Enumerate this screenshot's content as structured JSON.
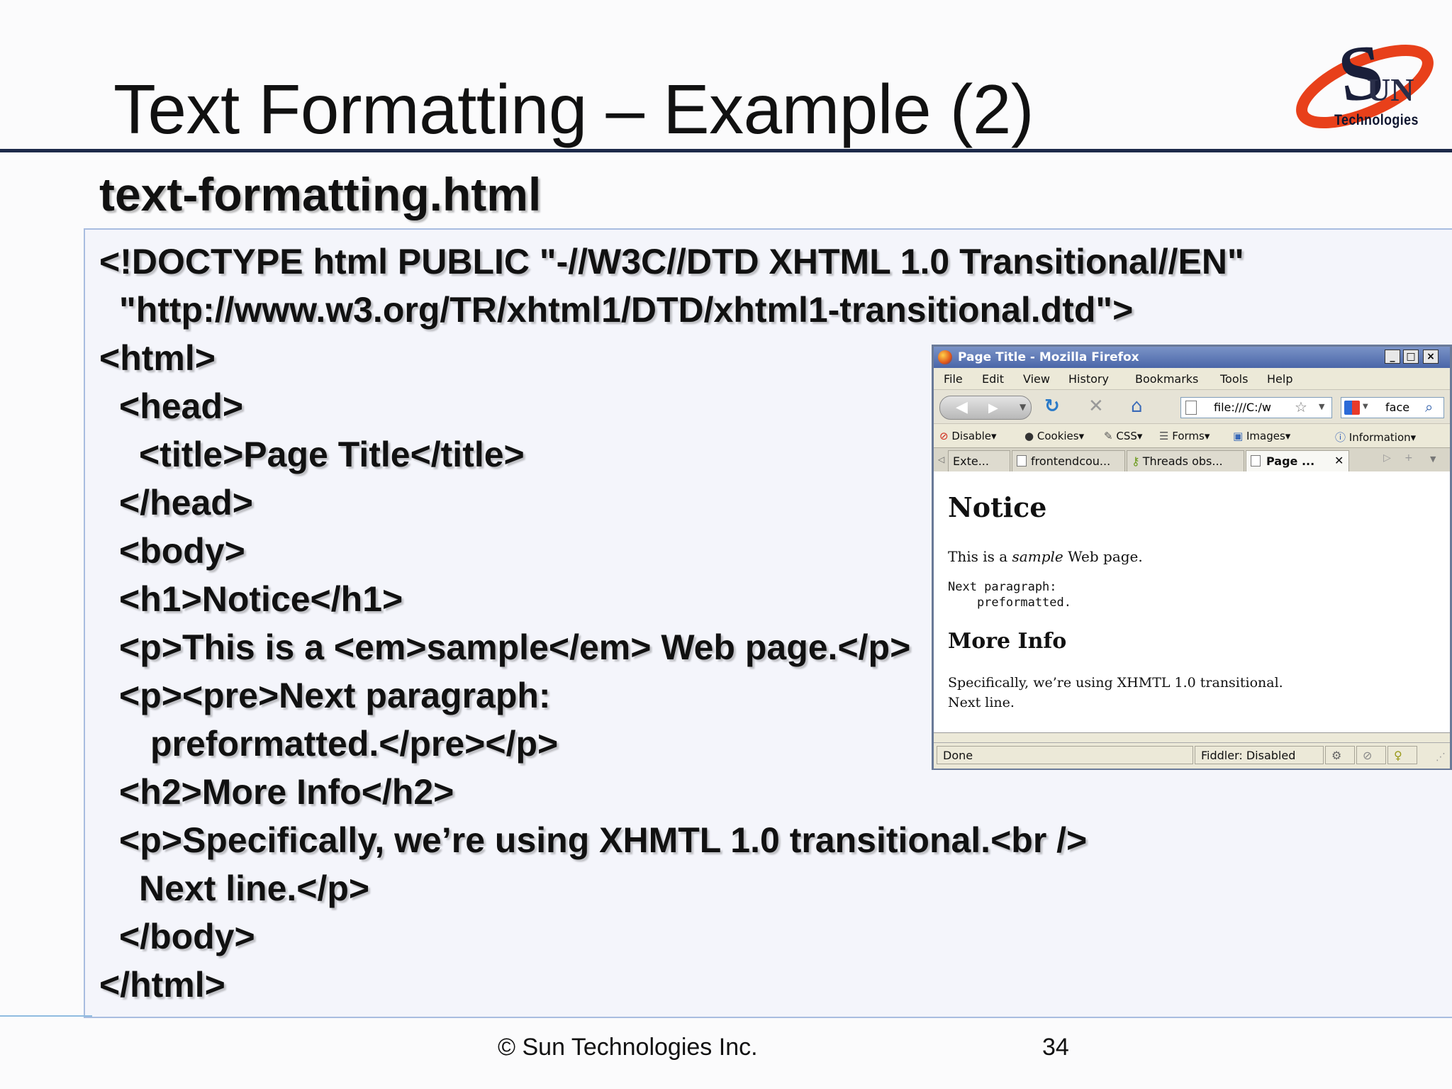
{
  "slide": {
    "title": "Text Formatting – Example (2)",
    "logo_text": "Technologies",
    "filename": "text-formatting.html"
  },
  "code_lines": [
    "<!DOCTYPE html PUBLIC \"-//W3C//DTD XHTML 1.0 Transitional//EN\"",
    "\"http://www.w3.org/TR/xhtml1/DTD/xhtml1-transitional.dtd\">",
    "<html>",
    "<head>",
    "<title>Page Title</title>",
    "</head>",
    "<body>",
    "<h1>Notice</h1>",
    "<p>This is a <em>sample</em> Web page.</p>",
    "<p><pre>Next paragraph:",
    "preformatted.</pre></p>",
    "<h2>More Info</h2>",
    "<p>Specifically, we’re using XHMTL 1.0 transitional.<br />",
    "Next line.</p>",
    "</body>",
    "</html>"
  ],
  "browser": {
    "window_title": "Page Title - Mozilla Firefox",
    "menu": [
      "File",
      "Edit",
      "View",
      "History",
      "Bookmarks",
      "Tools",
      "Help"
    ],
    "url": "file:///C:/w",
    "search": "face",
    "webdev_toolbar": [
      "Disable",
      "Cookies",
      "CSS",
      "Forms",
      "Images",
      "Information"
    ],
    "tabs": [
      "Exte...",
      "frontendcou...",
      "Threads obs...",
      "Page ..."
    ],
    "content": {
      "h1": "Notice",
      "p1_before": "This is a ",
      "p1_em": "sample",
      "p1_after": " Web page.",
      "pre_line1": "Next paragraph:",
      "pre_line2": "    preformatted.",
      "h2": "More Info",
      "p2_line1": "Specifically, we’re using XHMTL 1.0 transitional.",
      "p2_line2": "Next line."
    },
    "status_left": "Done",
    "status_fiddler": "Fiddler: Disabled"
  },
  "footer": {
    "copyright": "© Sun Technologies Inc.",
    "page_number": "34"
  }
}
